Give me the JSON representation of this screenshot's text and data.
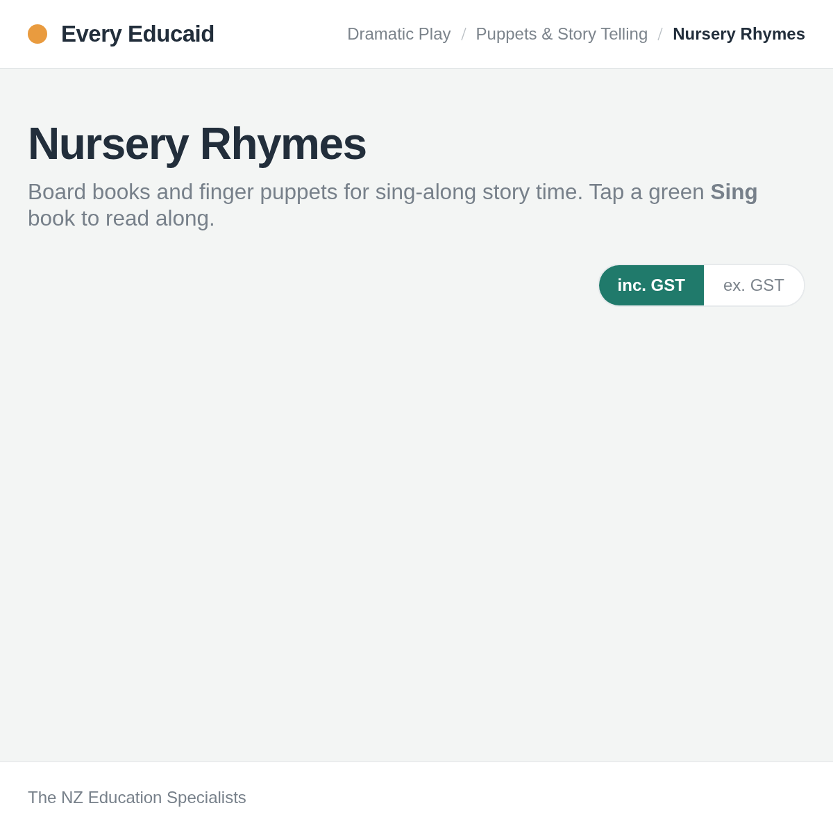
{
  "header": {
    "brand": "Every Educaid",
    "breadcrumbs": [
      {
        "label": "Dramatic Play",
        "current": false
      },
      {
        "label": "Puppets & Story Telling",
        "current": false
      },
      {
        "label": "Nursery Rhymes",
        "current": true
      }
    ]
  },
  "page": {
    "title": "Nursery Rhymes",
    "description": "Board books and finger puppets for sing-along story time. Tap a green **Sing** book to read along."
  },
  "price_toggle": [
    {
      "label": "inc. GST",
      "selected": true
    },
    {
      "label": "ex. GST",
      "selected": false
    }
  ],
  "footer": {
    "tagline": "The NZ Education Specialists"
  }
}
